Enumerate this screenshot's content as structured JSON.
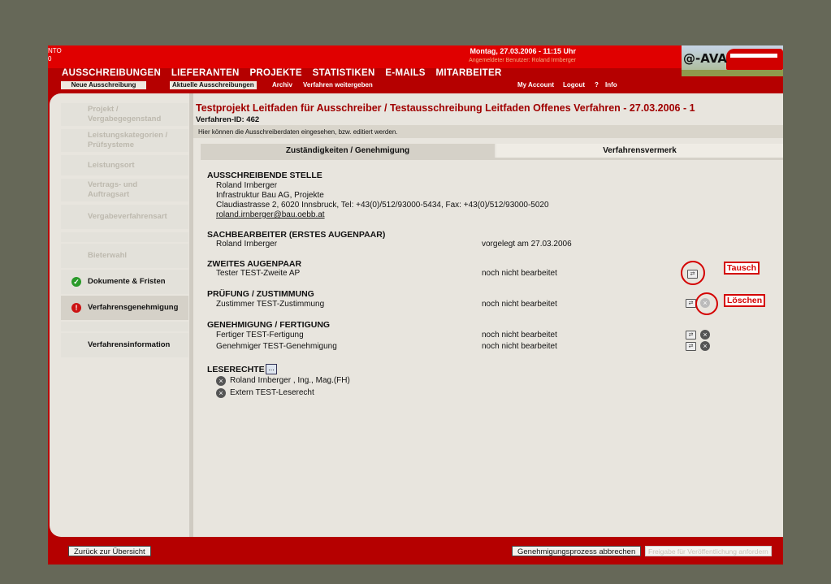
{
  "header": {
    "left_code_1": "NTO",
    "left_code_2": "0",
    "date": "Montag, 27.03.2006 - 11:15 Uhr",
    "user": "Angemeldeter Benutzer: Roland Irmberger",
    "logo": "@-AVA"
  },
  "main_nav": [
    "AUSSCHREIBUNGEN",
    "LIEFERANTEN",
    "PROJEKTE",
    "STATISTIKEN",
    "E-MAILS",
    "MITARBEITER"
  ],
  "sub_nav": {
    "new": "Neue Ausschreibung",
    "current": "Aktuelle Ausschreibungen",
    "archive": "Archiv",
    "forward": "Verfahren weitergeben",
    "account": "My Account",
    "logout": "Logout",
    "help": "?",
    "info": "Info"
  },
  "sidebar": [
    {
      "label": "Projekt /\nVergabegegenstand"
    },
    {
      "label": "Leistungskategorien /\nPrüfsysteme"
    },
    {
      "label": "Leistungsort"
    },
    {
      "label": "Vertrags- und\nAuftragsart"
    },
    {
      "label": "Vergabeverfahrensart"
    },
    {
      "label": "Bieterwahl"
    },
    {
      "label": "Dokumente & Fristen",
      "status": "ok"
    },
    {
      "label": "Verfahrensgenehmigung",
      "status": "error"
    },
    {
      "label": "Verfahrensinformation"
    }
  ],
  "page": {
    "title": "Testprojekt Leitfaden für Ausschreiber / Testausschreibung Leitfaden Offenes Verfahren - 27.03.2006 - 1",
    "verfahren_id": "Verfahren-ID: 462",
    "hint": "Hier können die Ausschreiberdaten eingesehen, bzw. editiert werden."
  },
  "tabs": [
    "Zuständigkeiten / Genehmigung",
    "Verfahrensvermerk"
  ],
  "sections": {
    "stelle": {
      "title": "AUSSCHREIBENDE STELLE",
      "name": "Roland Irnberger",
      "org": "Infrastruktur Bau AG, Projekte",
      "address": "Claudiastrasse 2, 6020 Innsbruck, Tel: +43(0)/512/93000-5434, Fax: +43(0)/512/93000-5020",
      "email": "roland.irnberger@bau.oebb.at"
    },
    "sachbearbeiter": {
      "title": "SACHBEARBEITER (ERSTES AUGENPAAR)",
      "name": "Roland Irnberger",
      "status": "vorgelegt am 27.03.2006"
    },
    "zweites": {
      "title": "ZWEITES AUGENPAAR",
      "name": "Tester TEST-Zweite AP",
      "status": "noch nicht bearbeitet"
    },
    "pruefung": {
      "title": "PRÜFUNG / ZUSTIMMUNG",
      "name": "Zustimmer TEST-Zustimmung",
      "status": "noch nicht bearbeitet"
    },
    "genehmigung": {
      "title": "GENEHMIGUNG / FERTIGUNG",
      "name1": "Fertiger TEST-Fertigung",
      "status1": "noch nicht bearbeitet",
      "name2": "Genehmiger TEST-Genehmigung",
      "status2": "noch nicht bearbeitet"
    },
    "leserechte": {
      "title": "LESERECHTE",
      "btn": "...",
      "items": [
        "Roland Irnberger , Ing., Mag.(FH)",
        "Extern TEST-Leserecht"
      ]
    }
  },
  "annotations": {
    "tausch": "Tausch",
    "loeschen": "Löschen"
  },
  "footer": {
    "back": "Zurück zur Übersicht",
    "abort": "Genehmigungsprozess abbrechen",
    "release": "Freigabe für Veröffentlichung anfordern"
  },
  "icons": {
    "swap": "swap-icon",
    "delete": "delete-icon",
    "ok": "check-icon",
    "error": "alert-icon"
  },
  "colors": {
    "brand_red": "#e00000",
    "dark_red": "#b50000",
    "title_red": "#a00000",
    "panel": "#e8e5de",
    "backdrop": "#666858"
  }
}
